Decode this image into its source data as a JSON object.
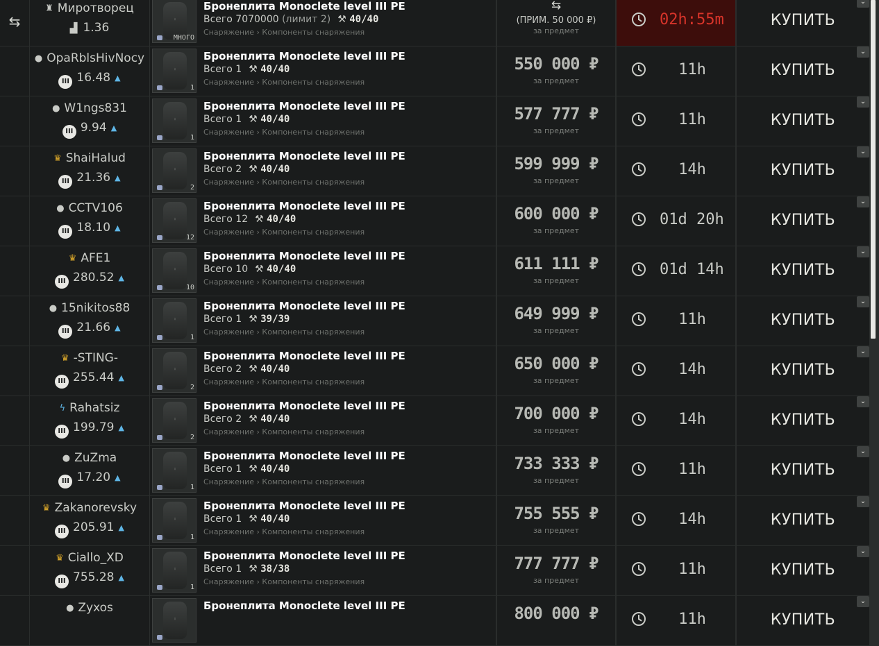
{
  "ui": {
    "buy_label": "КУПИТЬ",
    "per_item_label": "за предмет",
    "total_prefix": "Всего",
    "category": "Снаряжение › Компоненты снаряжения",
    "currency_symbol": "₽",
    "expand_icon": "chevron-down-icon",
    "barter_icon": "barter-exchange-icon"
  },
  "colors": {
    "row_bg": "#1a1c1c",
    "urgent_bg": "#3d0d0b",
    "urgent_text": "#d8342a",
    "rating_up": "#5fb6e6",
    "crown": "#d7a52a"
  },
  "offers": [
    {
      "seller": "Миротворец",
      "seller_icon": "trader-icon",
      "seller_glyph": "♜",
      "rating": "1.36",
      "rating_icon": "trader-level-icon",
      "rating_glyph": "📶",
      "rating_up": false,
      "title": "Бронеплита Monoclete level III PE",
      "total": "7070000",
      "limit": "(лимит 2)",
      "durability": "40",
      "durability_max": "/40",
      "qty_badge": "МНОГО",
      "barter": true,
      "barter_approx": "(ПРИМ. 50 000 ₽)",
      "price": "",
      "time": "02h:55m",
      "urgent": true
    },
    {
      "seller": "OpaRblsHivNocy",
      "seller_icon": "user-icon",
      "seller_glyph": "●",
      "rating": "16.48",
      "rating_icon": "reputation-icon",
      "rating_up": true,
      "title": "Бронеплита Monoclete level III PE",
      "total": "1",
      "limit": "",
      "durability": "40",
      "durability_max": "/40",
      "qty_badge": "1",
      "barter": false,
      "price": "550 000",
      "time": "11h",
      "urgent": false
    },
    {
      "seller": "W1ngs831",
      "seller_icon": "user-icon",
      "seller_glyph": "●",
      "rating": "9.94",
      "rating_icon": "reputation-icon",
      "rating_up": true,
      "title": "Бронеплита Monoclete level III PE",
      "total": "1",
      "limit": "",
      "durability": "40",
      "durability_max": "/40",
      "qty_badge": "1",
      "barter": false,
      "price": "577 777",
      "time": "11h",
      "urgent": false
    },
    {
      "seller": "ShaiHalud",
      "seller_icon": "crown-icon",
      "seller_glyph": "♛",
      "rating": "21.36",
      "rating_icon": "reputation-icon",
      "rating_up": true,
      "title": "Бронеплита Monoclete level III PE",
      "total": "2",
      "limit": "",
      "durability": "40",
      "durability_max": "/40",
      "qty_badge": "2",
      "barter": false,
      "price": "599 999",
      "time": "14h",
      "urgent": false
    },
    {
      "seller": "CCTV106",
      "seller_icon": "user-icon",
      "seller_glyph": "●",
      "rating": "18.10",
      "rating_icon": "reputation-icon",
      "rating_up": true,
      "title": "Бронеплита Monoclete level III PE",
      "total": "12",
      "limit": "",
      "durability": "40",
      "durability_max": "/40",
      "qty_badge": "12",
      "barter": false,
      "price": "600 000",
      "time": "01d 20h",
      "urgent": false
    },
    {
      "seller": "AFE1",
      "seller_icon": "crown-icon",
      "seller_glyph": "♛",
      "rating": "280.52",
      "rating_icon": "reputation-icon",
      "rating_up": true,
      "title": "Бронеплита Monoclete level III PE",
      "total": "10",
      "limit": "",
      "durability": "40",
      "durability_max": "/40",
      "qty_badge": "10",
      "barter": false,
      "price": "611 111",
      "time": "01d 14h",
      "urgent": false
    },
    {
      "seller": "15nikitos88",
      "seller_icon": "user-icon",
      "seller_glyph": "●",
      "rating": "21.66",
      "rating_icon": "reputation-icon",
      "rating_up": true,
      "title": "Бронеплита Monoclete level III PE",
      "total": "1",
      "limit": "",
      "durability": "39",
      "durability_max": "/39",
      "qty_badge": "1",
      "barter": false,
      "price": "649 999",
      "time": "11h",
      "urgent": false
    },
    {
      "seller": "-STING-",
      "seller_icon": "crown-icon",
      "seller_glyph": "♛",
      "rating": "255.44",
      "rating_icon": "reputation-icon",
      "rating_up": true,
      "title": "Бронеплита Monoclete level III PE",
      "total": "2",
      "limit": "",
      "durability": "40",
      "durability_max": "/40",
      "qty_badge": "2",
      "barter": false,
      "price": "650 000",
      "time": "14h",
      "urgent": false
    },
    {
      "seller": "Rahatsiz",
      "seller_icon": "lightning-icon",
      "seller_glyph": "ϟ",
      "rating": "199.79",
      "rating_icon": "reputation-icon",
      "rating_up": true,
      "title": "Бронеплита Monoclete level III PE",
      "total": "2",
      "limit": "",
      "durability": "40",
      "durability_max": "/40",
      "qty_badge": "2",
      "barter": false,
      "price": "700 000",
      "time": "14h",
      "urgent": false
    },
    {
      "seller": "ZuZma",
      "seller_icon": "user-icon",
      "seller_glyph": "●",
      "rating": "17.20",
      "rating_icon": "reputation-icon",
      "rating_up": true,
      "title": "Бронеплита Monoclete level III PE",
      "total": "1",
      "limit": "",
      "durability": "40",
      "durability_max": "/40",
      "qty_badge": "1",
      "barter": false,
      "price": "733 333",
      "time": "11h",
      "urgent": false
    },
    {
      "seller": "Zakanorevsky",
      "seller_icon": "crown-icon",
      "seller_glyph": "♛",
      "rating": "205.91",
      "rating_icon": "reputation-icon",
      "rating_up": true,
      "title": "Бронеплита Monoclete level III PE",
      "total": "1",
      "limit": "",
      "durability": "40",
      "durability_max": "/40",
      "qty_badge": "1",
      "barter": false,
      "price": "755 555",
      "time": "14h",
      "urgent": false
    },
    {
      "seller": "Ciallo_XD",
      "seller_icon": "crown-icon",
      "seller_glyph": "♛",
      "rating": "755.28",
      "rating_icon": "reputation-icon",
      "rating_up": true,
      "title": "Бронеплита Monoclete level III PE",
      "total": "1",
      "limit": "",
      "durability": "38",
      "durability_max": "/38",
      "qty_badge": "1",
      "barter": false,
      "price": "777 777",
      "time": "11h",
      "urgent": false
    },
    {
      "seller": "Zyxos",
      "seller_icon": "user-icon",
      "seller_glyph": "●",
      "rating": "",
      "rating_icon": "reputation-icon",
      "rating_up": false,
      "title": "Бронеплита Monoclete level III PE",
      "total": "",
      "limit": "",
      "durability": "",
      "durability_max": "",
      "qty_badge": "",
      "barter": false,
      "price": "800 000",
      "time": "11h",
      "urgent": false
    }
  ]
}
